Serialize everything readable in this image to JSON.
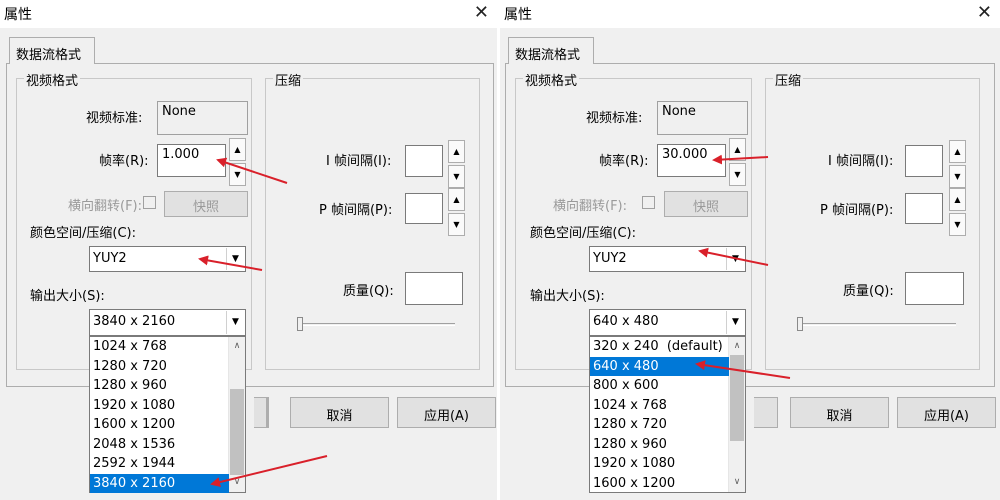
{
  "left": {
    "title": "属性",
    "tab": "数据流格式",
    "video_group": "视频格式",
    "compress_group": "压缩",
    "video_standard_label": "视频标准:",
    "video_standard_value": "None",
    "frame_rate_label": "帧率(R):",
    "frame_rate_value": "1.000",
    "flip_label": "横向翻转(F):",
    "snapshot_label": "快照",
    "colorspace_label": "颜色空间/压缩(C):",
    "colorspace_value": "YUY2",
    "output_size_label": "输出大小(S):",
    "output_size_value": "3840 x 2160",
    "i_interval_label": "I 帧间隔(I):",
    "p_interval_label": "P 帧间隔(P):",
    "quality_label": "质量(Q):",
    "cancel_label": "取消",
    "apply_label": "应用(A)",
    "dropdown_items": [
      "1024 x 768",
      "1280 x 720",
      "1280 x 960",
      "1920 x 1080",
      "1600 x 1200",
      "2048 x 1536",
      "2592 x 1944",
      "3840 x 2160"
    ],
    "selected_index": 7
  },
  "right": {
    "title": "属性",
    "tab": "数据流格式",
    "video_group": "视频格式",
    "compress_group": "压缩",
    "video_standard_label": "视频标准:",
    "video_standard_value": "None",
    "frame_rate_label": "帧率(R):",
    "frame_rate_value": "30.000",
    "flip_label": "横向翻转(F):",
    "snapshot_label": "快照",
    "colorspace_label": "颜色空间/压缩(C):",
    "colorspace_value": "YUY2",
    "output_size_label": "输出大小(S):",
    "output_size_value": "640 x 480",
    "i_interval_label": "I 帧间隔(I):",
    "p_interval_label": "P 帧间隔(P):",
    "quality_label": "质量(Q):",
    "cancel_label": "取消",
    "apply_label": "应用(A)",
    "dropdown_items": [
      "320 x 240  (default)",
      "640 x 480",
      "800 x 600",
      "1024 x 768",
      "1280 x 720",
      "1280 x 960",
      "1920 x 1080",
      "1600 x 1200"
    ],
    "selected_index": 1
  },
  "colors": {
    "annotation_arrow": "#d9202a",
    "selection": "#0078d7"
  }
}
